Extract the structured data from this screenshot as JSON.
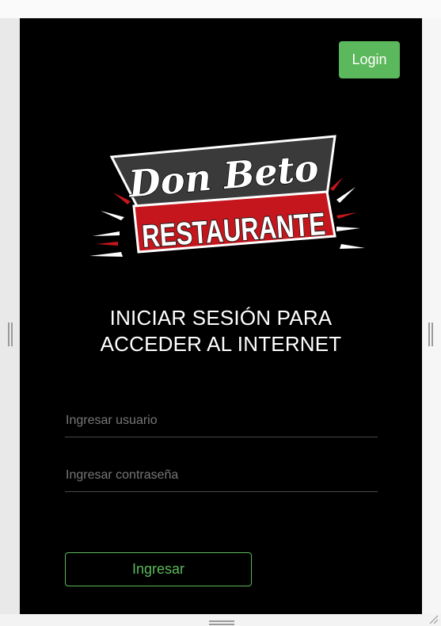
{
  "header": {
    "login_label": "Login"
  },
  "logo": {
    "line1": "Don Beto",
    "line2": "RESTAURANTE"
  },
  "title": {
    "line1": "INICIAR SESIÓN PARA",
    "line2": "ACCEDER AL INTERNET"
  },
  "form": {
    "username_placeholder": "Ingresar usuario",
    "username_value": "",
    "password_placeholder": "Ingresar contraseña",
    "password_value": "",
    "submit_label": "Ingresar"
  },
  "colors": {
    "accent": "#5cb85c",
    "panel_background": "#000000",
    "logo_red": "#c4161c",
    "logo_dark": "#3a3a3a"
  }
}
